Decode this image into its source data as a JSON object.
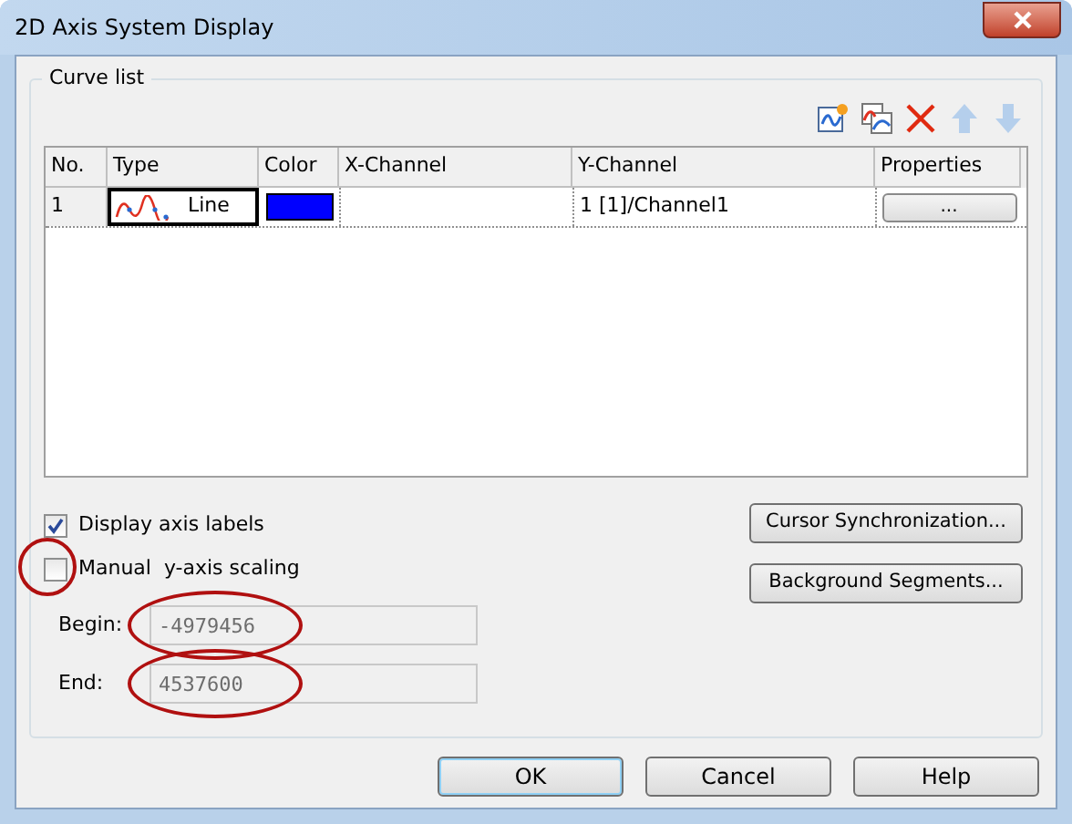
{
  "window": {
    "title": "2D Axis System Display"
  },
  "curve_list": {
    "title": "Curve list",
    "toolbar": [
      {
        "kind": "new",
        "disabled": false
      },
      {
        "kind": "copy",
        "disabled": false
      },
      {
        "kind": "delete",
        "disabled": false
      },
      {
        "kind": "up",
        "disabled": true
      },
      {
        "kind": "down",
        "disabled": true
      }
    ],
    "columns": [
      "No.",
      "Type",
      "Color",
      "X-Channel",
      "Y-Channel",
      "Properties"
    ],
    "rows": [
      {
        "no": "1",
        "type": "Line",
        "color": "#0000ff",
        "x_channel": "",
        "y_channel": "1 [1]/Channel1",
        "properties": "...",
        "selected": true
      }
    ]
  },
  "options": [
    {
      "label": "Display axis labels",
      "checked": true,
      "circled": false
    },
    {
      "label": "Manual  y-axis scaling",
      "checked": false,
      "circled": true
    }
  ],
  "fields": [
    {
      "label": "Begin:",
      "value": "-4979456",
      "disabled": true,
      "circled": true
    },
    {
      "label": "End:",
      "value": "4537600",
      "disabled": true,
      "circled": true
    }
  ],
  "side_buttons": [
    "Cursor Synchronization...",
    "Background Segments..."
  ],
  "buttons": [
    {
      "label": "OK",
      "default": true
    },
    {
      "label": "Cancel",
      "default": false
    },
    {
      "label": "Help",
      "default": false
    }
  ]
}
